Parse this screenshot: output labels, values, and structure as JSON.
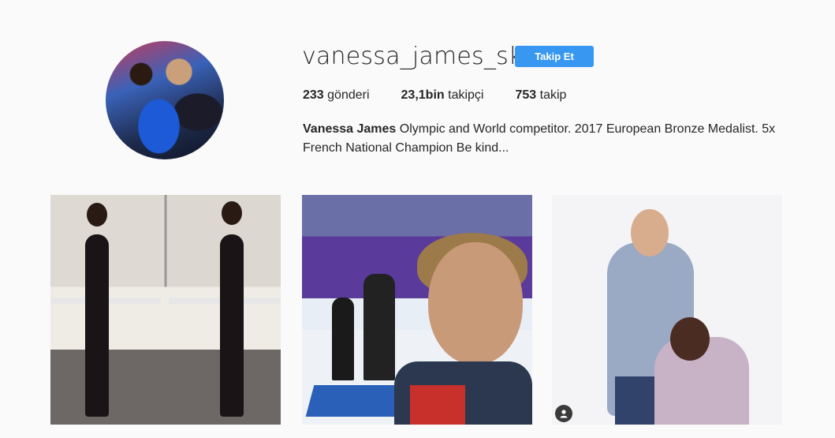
{
  "profile": {
    "username": "vanessa_james_sk8",
    "follow_label": "Takip Et",
    "stats": {
      "posts_count": "233",
      "posts_label": "gönderi",
      "followers_count": "23,1bin",
      "followers_label": "takipçi",
      "following_count": "753",
      "following_label": "takip"
    },
    "bio": {
      "name": "Vanessa James",
      "text": "Olympic and World competitor. 2017 European Bronze Medalist. 5x French National Champion Be kind..."
    }
  },
  "colors": {
    "accent": "#3897f0",
    "background": "#fafafa",
    "text": "#262626"
  },
  "icons": {
    "tagged": "user-tag-icon"
  }
}
